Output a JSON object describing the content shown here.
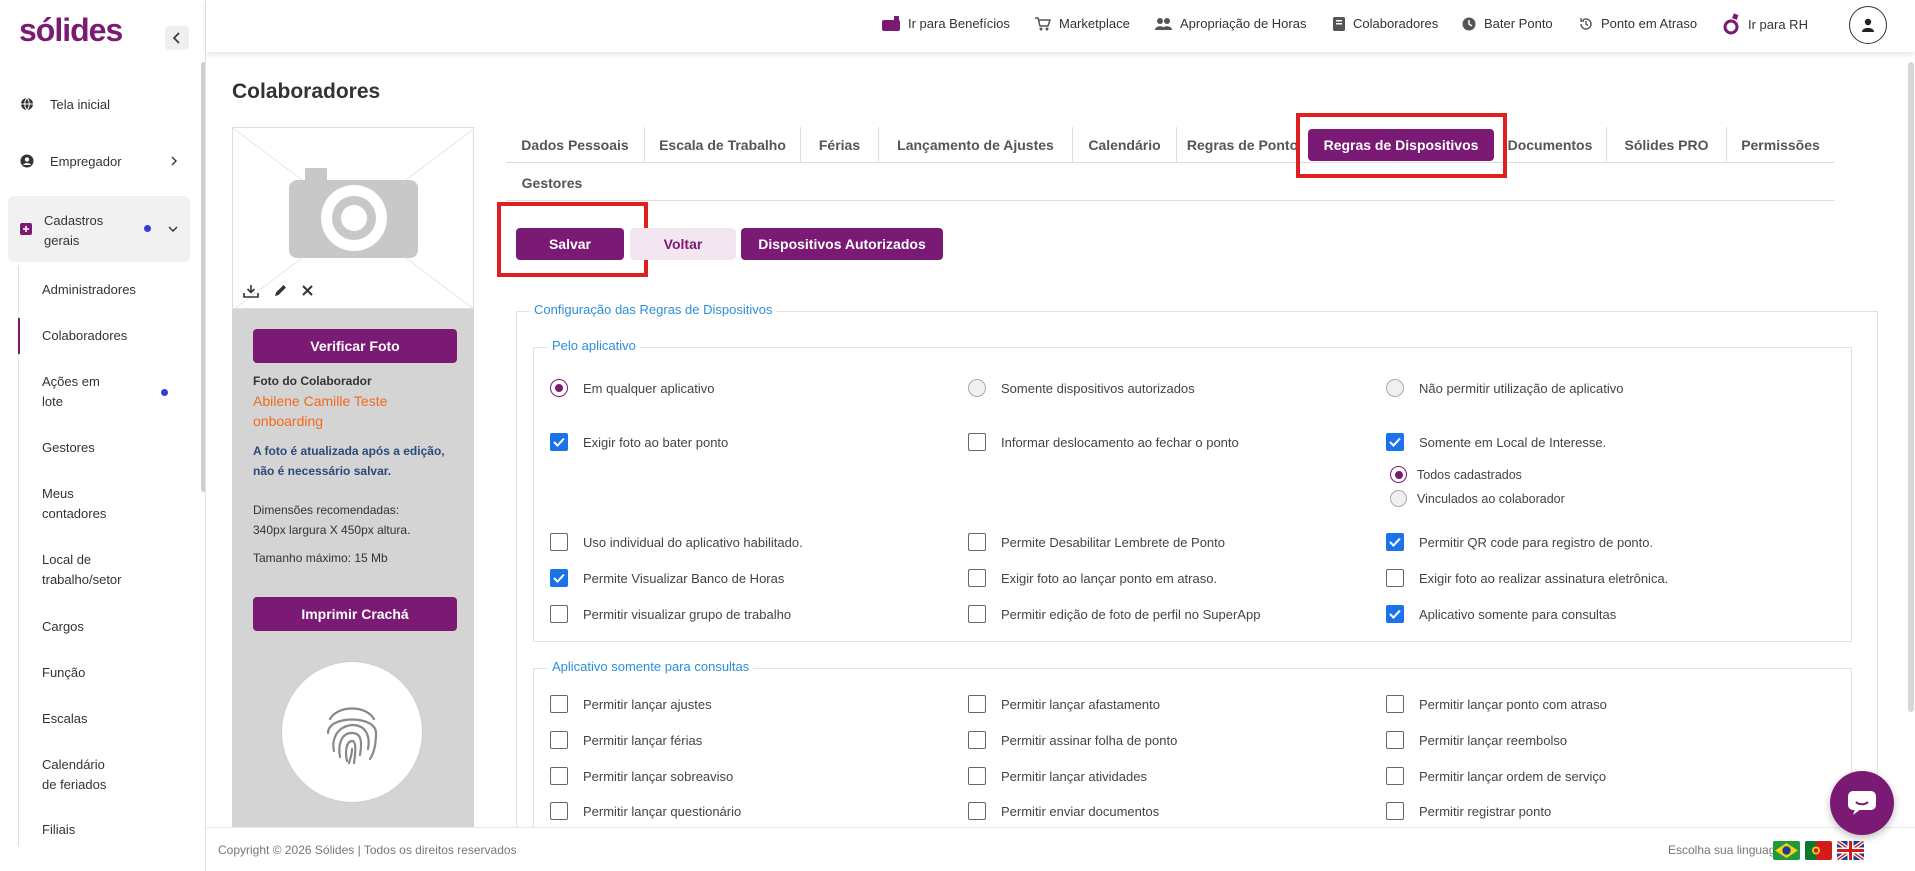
{
  "brand": "sólides",
  "colors": {
    "primary": "#7a1a75",
    "checkbox": "#1a73e8",
    "legend": "#2d8fd8",
    "highlight": "#e02020",
    "employee_name": "#f26a1b"
  },
  "sidebar": {
    "items": [
      {
        "label": "Tela inicial",
        "icon": "globe-icon"
      },
      {
        "label": "Empregador",
        "icon": "user-circle-icon"
      }
    ],
    "group": {
      "label_line1": "Cadastros",
      "label_line2": "gerais",
      "icon": "plus-square-icon"
    },
    "subitems": [
      "Administradores",
      "Colaboradores",
      "Ações em lote",
      "Gestores",
      "Meus contadores",
      "Local de trabalho/setor",
      "Cargos",
      "Função",
      "Escalas",
      "Calendário de feriados",
      "Filiais"
    ]
  },
  "topbar": {
    "items": [
      {
        "label": "Ir para Benefícios",
        "icon": "gift-icon"
      },
      {
        "label": "Marketplace",
        "icon": "cart-icon"
      },
      {
        "label": "Apropriação de Horas",
        "icon": "users-icon"
      },
      {
        "label": "Colaboradores",
        "icon": "book-icon"
      },
      {
        "label": "Bater Ponto",
        "icon": "clock-icon"
      },
      {
        "label": "Ponto em Atraso",
        "icon": "history-icon"
      },
      {
        "label": "Ir para RH",
        "icon": "solides-logo-icon"
      }
    ]
  },
  "page": {
    "title": "Colaboradores"
  },
  "photo_panel": {
    "verify_button": "Verificar Foto",
    "photo_label": "Foto do Colaborador",
    "employee_name_line1": "Abilene Camille Teste",
    "employee_name_line2": "onboarding",
    "note_line1": "A foto é atualizada após a edição,",
    "note_line2": "não é necessário salvar.",
    "dims_line1": "Dimensões recomendadas:",
    "dims_line2": "340px largura X 450px altura.",
    "max_size": "Tamanho máximo: 15 Mb",
    "badge_button": "Imprimir Crachá"
  },
  "tabs": [
    "Dados Pessoais",
    "Escala de Trabalho",
    "Férias",
    "Lançamento de Ajustes",
    "Calendário",
    "Regras de Ponto",
    "Regras de Dispositivos",
    "Documentos",
    "Sólides PRO",
    "Permissões",
    "Gestores"
  ],
  "active_tab": "Regras de Dispositivos",
  "actions": {
    "save": "Salvar",
    "back": "Voltar",
    "authorized": "Dispositivos Autorizados"
  },
  "config": {
    "legend": "Configuração das Regras de Dispositivos",
    "app_section": {
      "legend": "Pelo aplicativo",
      "radios": [
        {
          "label": "Em qualquer aplicativo",
          "selected": true
        },
        {
          "label": "Somente dispositivos autorizados",
          "selected": false
        },
        {
          "label": "Não permitir utilização de aplicativo",
          "selected": false
        }
      ],
      "row1": [
        {
          "label": "Exigir foto ao bater ponto",
          "checked": true
        },
        {
          "label": "Informar deslocamento ao fechar o ponto",
          "checked": false
        },
        {
          "label": "Somente em Local de Interesse.",
          "checked": true
        }
      ],
      "sub_radios": [
        {
          "label": "Todos cadastrados",
          "selected": true
        },
        {
          "label": "Vinculados ao colaborador",
          "selected": false
        }
      ],
      "row2": [
        {
          "label": "Uso individual do aplicativo habilitado.",
          "checked": false
        },
        {
          "label": "Permite Desabilitar Lembrete de Ponto",
          "checked": false
        },
        {
          "label": "Permitir QR code para registro de ponto.",
          "checked": true
        }
      ],
      "row3": [
        {
          "label": "Permite Visualizar Banco de Horas",
          "checked": true
        },
        {
          "label": "Exigir foto ao lançar ponto em atraso.",
          "checked": false
        },
        {
          "label": "Exigir foto ao realizar assinatura eletrônica.",
          "checked": false
        }
      ],
      "row4": [
        {
          "label": "Permitir visualizar grupo de trabalho",
          "checked": false
        },
        {
          "label": "Permitir edição de foto de perfil no SuperApp",
          "checked": false
        },
        {
          "label": "Aplicativo somente para consultas",
          "checked": true
        }
      ]
    },
    "consult_section": {
      "legend": "Aplicativo somente para consultas",
      "rows": [
        [
          "Permitir lançar ajustes",
          "Permitir lançar afastamento",
          "Permitir lançar ponto com atraso"
        ],
        [
          "Permitir lançar férias",
          "Permitir assinar folha de ponto",
          "Permitir lançar reembolso"
        ],
        [
          "Permitir lançar sobreaviso",
          "Permitir lançar atividades",
          "Permitir lançar ordem de serviço"
        ],
        [
          "Permitir lançar questionário",
          "Permitir enviar documentos",
          "Permitir registrar ponto"
        ]
      ]
    }
  },
  "footer": {
    "copyright": "Copyright © 2026 Sólides | Todos os direitos reservados",
    "language_label": "Escolha sua linguagem:"
  }
}
